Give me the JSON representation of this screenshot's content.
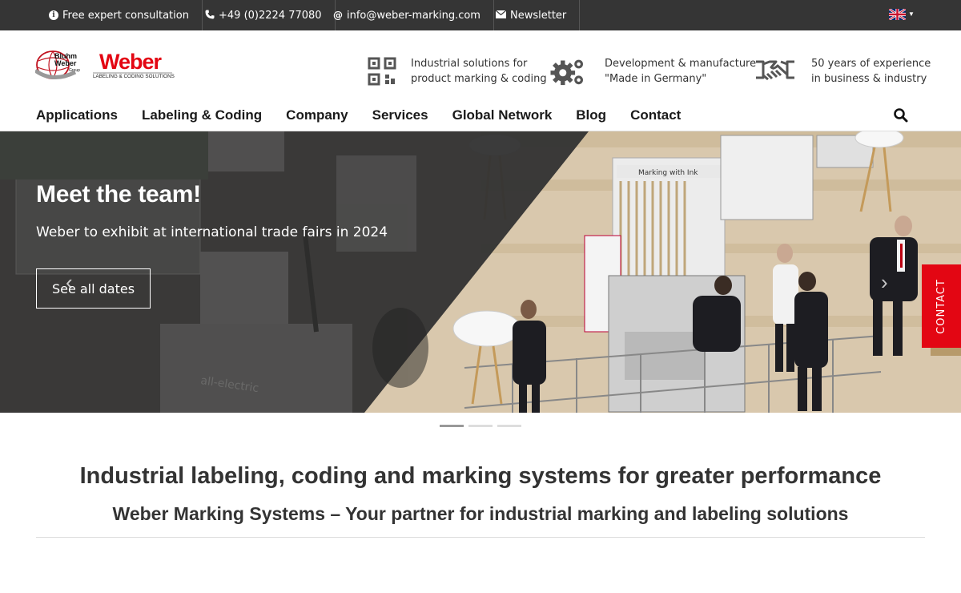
{
  "topbar": {
    "consultation": "Free expert consultation",
    "phone": "+49 (0)2224 77080",
    "email": "info@weber-marking.com",
    "newsletter": "Newsletter",
    "icons": [
      "info-icon",
      "phone-icon",
      "at-icon",
      "envelope-icon"
    ],
    "language_flag": "uk-flag-icon"
  },
  "logo": {
    "group_line1": "Bluhm",
    "group_line2": "Weber",
    "group_line3": "Group",
    "brand": "Weber",
    "tagline": "LABELING & CODING SOLUTIONS"
  },
  "features": [
    {
      "icon": "qr-code-icon",
      "line1": "Industrial solutions for",
      "line2": "product marking & coding"
    },
    {
      "icon": "gears-icon",
      "line1": "Development & manufacture",
      "line2": "\"Made in Germany\""
    },
    {
      "icon": "handshake-icon",
      "line1": "50 years of experience",
      "line2": "in business & industry"
    }
  ],
  "nav": {
    "items": [
      "Applications",
      "Labeling & Coding",
      "Company",
      "Services",
      "Global Network",
      "Blog",
      "Contact"
    ]
  },
  "hero": {
    "title": "Meet the team!",
    "subtitle": "Weber to exhibit at international trade fairs in 2024",
    "button": "See all dates",
    "sign_text": "Marking with Ink",
    "machine_text": "all-electric",
    "slides_total": 3,
    "slide_active": 1
  },
  "contact_tab": "CONTACT",
  "intro": {
    "heading": "Industrial labeling, coding and marking systems for greater performance",
    "subheading": "Weber Marking Systems – Your partner for industrial marking and labeling solutions"
  },
  "colors": {
    "topbar": "#353535",
    "accent_red": "#e30613",
    "text_dark": "#1a1a1a"
  }
}
